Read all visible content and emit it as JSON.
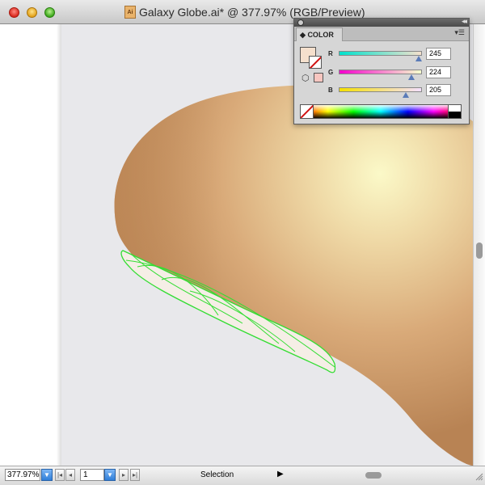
{
  "window": {
    "title": "Galaxy Globe.ai* @ 377.97% (RGB/Preview)",
    "doc_icon_text": "Ai"
  },
  "color_panel": {
    "tab_label": "COLOR",
    "tab_marker": "◆",
    "fill_color": "#f5e0cd",
    "channels": [
      {
        "label": "R",
        "value": "245",
        "fraction": 0.961
      },
      {
        "label": "G",
        "value": "224",
        "fraction": 0.878
      },
      {
        "label": "B",
        "value": "205",
        "fraction": 0.804
      }
    ]
  },
  "statusbar": {
    "zoom": "377.97%",
    "page": "1",
    "tool": "Selection"
  },
  "colors": {
    "selection_outline": "#33dd33",
    "shape_light": "#fbf7cc",
    "shape_mid": "#d8a877",
    "shape_dark": "#b7804d",
    "selected_fill": "#f5eee6"
  }
}
